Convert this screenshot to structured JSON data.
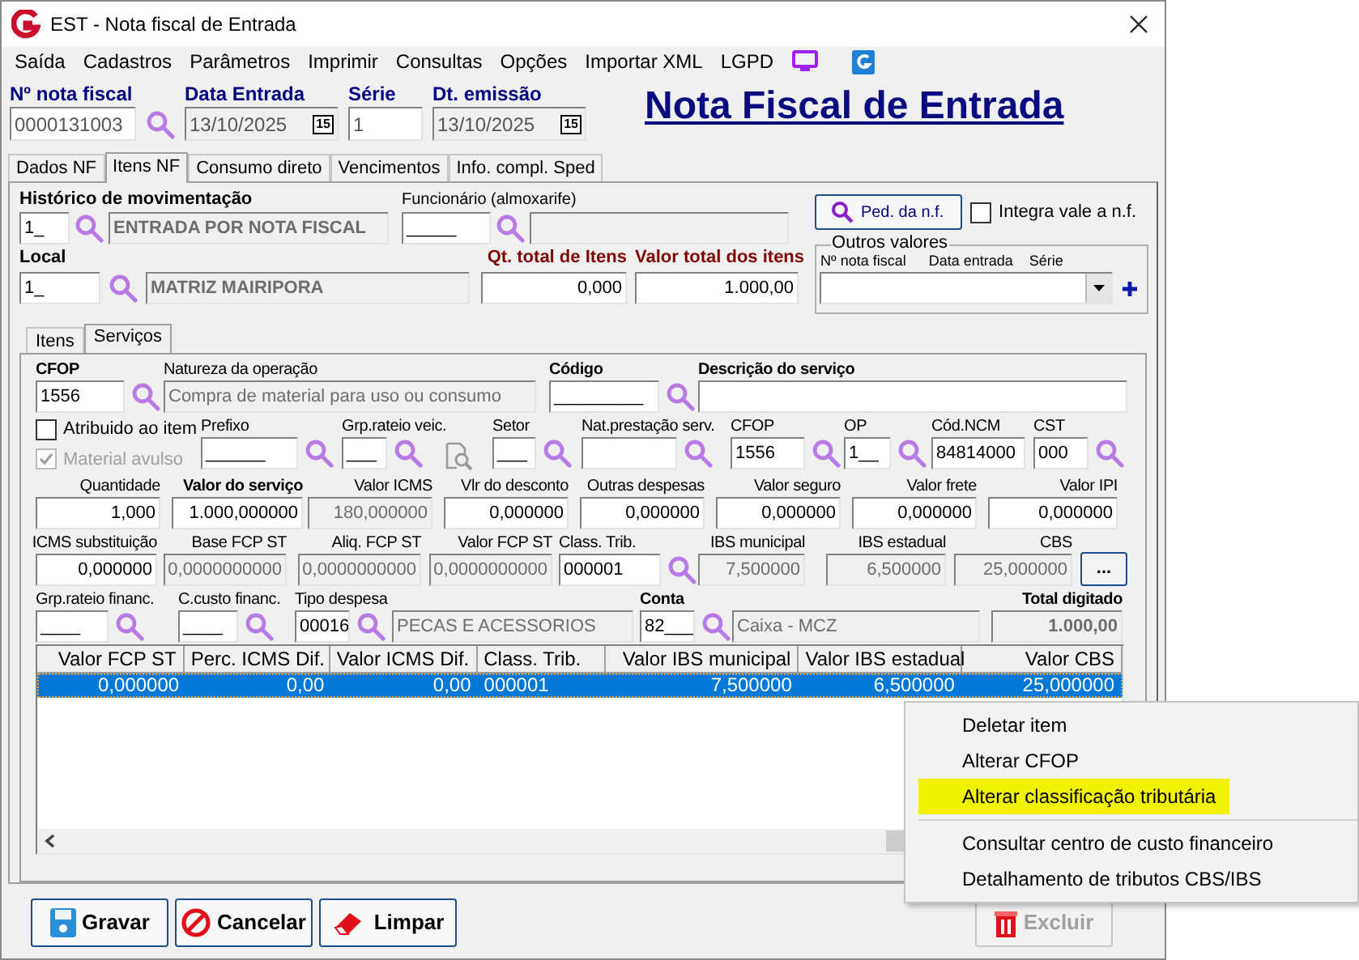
{
  "window": {
    "title": "EST - Nota fiscal de Entrada"
  },
  "menu": [
    {
      "label": "Saída"
    },
    {
      "label": "Cadastros"
    },
    {
      "label": "Parâmetros"
    },
    {
      "label": "Imprimir"
    },
    {
      "label": "Consultas"
    },
    {
      "label": "Opções"
    },
    {
      "label": "Importar XML"
    },
    {
      "label": "LGPD"
    }
  ],
  "header": {
    "title": "Nota Fiscal de Entrada",
    "fields": [
      {
        "label": "Nº nota fiscal",
        "value": "0000131003",
        "readonly": false,
        "lookup": true
      },
      {
        "label": "Data Entrada",
        "value": "13/10/2025",
        "readonly": true,
        "calendar": "15"
      },
      {
        "label": "Série",
        "value": "1",
        "readonly": false
      },
      {
        "label": "Dt. emissão",
        "value": "13/10/2025",
        "readonly": true,
        "calendar": "15"
      }
    ]
  },
  "tabs": [
    {
      "label": "Dados NF",
      "selected": false
    },
    {
      "label": "Itens NF",
      "selected": true
    },
    {
      "label": "Consumo direto",
      "selected": false
    },
    {
      "label": "Vencimentos",
      "selected": false
    },
    {
      "label": "Info. compl. Sped",
      "selected": false
    }
  ],
  "historico": {
    "label": "Histórico de movimentação",
    "code": "1_",
    "description": "ENTRADA POR NOTA FISCAL"
  },
  "funcionario": {
    "label": "Funcionário (almoxarife)",
    "code": "_____"
  },
  "pedido_button": {
    "label": "Ped. da n.f."
  },
  "integra_vale": {
    "label": "Integra vale a n.f.",
    "checked": false
  },
  "outros_valores": {
    "title": "Outros valores",
    "columns": [
      "Nº nota fiscal",
      "Data entrada",
      "Série"
    ]
  },
  "local": {
    "label": "Local",
    "code": "1_",
    "description": "MATRIZ MAIRIPORA"
  },
  "qt_total": {
    "label": "Qt. total de Itens",
    "value": "0,000"
  },
  "valor_total": {
    "label": "Valor total dos itens",
    "value": "1.000,00"
  },
  "subtabs": [
    {
      "label": "Itens",
      "selected": false
    },
    {
      "label": "Serviços",
      "selected": true
    }
  ],
  "servicos": {
    "rows": [
      {
        "fields": [
          {
            "kind": "field",
            "label": "CFOP",
            "strong": true,
            "value": "1556",
            "readonly": false,
            "lookup": true
          },
          {
            "kind": "field",
            "label": "Natureza da operação",
            "value": "Compra de material para uso ou consumo",
            "readonly": true
          },
          {
            "kind": "field",
            "label": "Código",
            "strong": true,
            "value": "_________",
            "readonly": false,
            "lookup": true
          },
          {
            "kind": "field",
            "label": "Descrição do serviço",
            "strong": true,
            "readonly": false
          }
        ]
      },
      {
        "fields": [
          {
            "kind": "checks",
            "items": [
              {
                "label": "Atribuido ao item",
                "checked": false,
                "disabled": false
              },
              {
                "label": "Material avulso",
                "checked": true,
                "disabled": true
              }
            ]
          },
          {
            "kind": "field",
            "label": "Prefixo",
            "value": "______",
            "readonly": false,
            "lookup": true
          },
          {
            "kind": "field",
            "label": "Grp.rateio veic.",
            "value": "___",
            "readonly": false,
            "lookup": true
          },
          {
            "kind": "tool"
          },
          {
            "kind": "field",
            "label": "Setor",
            "value": "___",
            "readonly": false,
            "lookup": true
          },
          {
            "kind": "field",
            "label": "Nat.prestação serv.",
            "readonly": false,
            "lookup": true
          },
          {
            "kind": "field",
            "label": "CFOP",
            "value": "1556",
            "readonly": false,
            "lookup": true
          },
          {
            "kind": "field",
            "label": "OP",
            "value": "1__",
            "readonly": false,
            "lookup": true
          },
          {
            "kind": "field",
            "label": "Cód.NCM",
            "value": "84814000",
            "readonly": false
          },
          {
            "kind": "field",
            "label": "CST",
            "value": "000",
            "readonly": false,
            "lookup": true
          }
        ]
      },
      {
        "fields": [
          {
            "kind": "field",
            "label": "Quantidade",
            "value": "1,000",
            "readonly": false,
            "numeric": true
          },
          {
            "kind": "field",
            "label": "Valor do serviço",
            "strong": true,
            "value": "1.000,000000",
            "readonly": false,
            "numeric": true
          },
          {
            "kind": "field",
            "label": "Valor ICMS",
            "value": "180,000000",
            "readonly": true,
            "numeric": true
          },
          {
            "kind": "field",
            "label": "Vlr do desconto",
            "value": "0,000000",
            "readonly": false,
            "numeric": true
          },
          {
            "kind": "field",
            "label": "Outras despesas",
            "value": "0,000000",
            "readonly": false,
            "numeric": true
          },
          {
            "kind": "field",
            "label": "Valor seguro",
            "value": "0,000000",
            "readonly": false,
            "numeric": true
          },
          {
            "kind": "field",
            "label": "Valor frete",
            "value": "0,000000",
            "readonly": false,
            "numeric": true
          },
          {
            "kind": "field",
            "label": "Valor IPI",
            "value": "0,000000",
            "readonly": false,
            "numeric": true
          }
        ]
      },
      {
        "fields": [
          {
            "kind": "field",
            "label": "ICMS substituição",
            "value": "0,000000",
            "readonly": false,
            "numeric": true
          },
          {
            "kind": "field",
            "label": "Base FCP ST",
            "value": "0,0000000000",
            "readonly": true,
            "numeric": true
          },
          {
            "kind": "field",
            "label": "Aliq. FCP ST",
            "value": "0,0000000000",
            "readonly": true,
            "numeric": true
          },
          {
            "kind": "field",
            "label": "Valor FCP ST",
            "value": "0,0000000000",
            "readonly": true,
            "numeric": true
          },
          {
            "kind": "field",
            "label": "Class. Trib.",
            "value": "000001",
            "readonly": false,
            "lookup": true
          },
          {
            "kind": "field",
            "label": "IBS municipal",
            "value": "7,500000",
            "readonly": true,
            "numeric": true
          },
          {
            "kind": "field",
            "label": "IBS estadual",
            "value": "6,500000",
            "readonly": true,
            "numeric": true
          },
          {
            "kind": "field",
            "label": "CBS",
            "value": "25,000000",
            "readonly": true,
            "numeric": true
          },
          {
            "kind": "button",
            "label": "..."
          }
        ]
      },
      {
        "fields": [
          {
            "kind": "field",
            "label": "Grp.rateio financ.",
            "value": "____",
            "readonly": false,
            "lookup": true
          },
          {
            "kind": "field",
            "label": "C.custo financ.",
            "value": "____",
            "readonly": false,
            "lookup": true
          },
          {
            "kind": "field",
            "label": "Tipo despesa",
            "value": "00016",
            "readonly": false,
            "lookup": true
          },
          {
            "kind": "field",
            "value": "PECAS E ACESSORIOS",
            "readonly": true
          },
          {
            "kind": "field",
            "label": "Conta",
            "strong": true,
            "value": "82___",
            "readonly": false,
            "lookup": true
          },
          {
            "kind": "field",
            "value": "Caixa - MCZ",
            "readonly": true
          },
          {
            "kind": "field",
            "label": "Total digitado",
            "strong": true,
            "value": "1.000,00",
            "readonly": true,
            "numeric": true
          }
        ]
      }
    ]
  },
  "grid": {
    "columns": [
      {
        "label": "Valor FCP ST"
      },
      {
        "label": "Perc. ICMS Dif."
      },
      {
        "label": "Valor ICMS Dif."
      },
      {
        "label": "Class. Trib."
      },
      {
        "label": "Valor IBS municipal"
      },
      {
        "label": "Valor IBS estadual"
      },
      {
        "label": "Valor CBS"
      }
    ],
    "rows": [
      {
        "selected": true,
        "cells": [
          "0,000000",
          "0,00",
          "0,00",
          "000001",
          "7,500000",
          "6,500000",
          "25,000000"
        ]
      }
    ]
  },
  "buttons": [
    {
      "kind": "save",
      "label": "Gravar",
      "disabled": false
    },
    {
      "kind": "cancel",
      "label": "Cancelar",
      "disabled": false
    },
    {
      "kind": "clear",
      "label": "Limpar",
      "disabled": false
    },
    {
      "kind": "delete",
      "label": "Excluir",
      "disabled": true
    }
  ],
  "context_menu": [
    {
      "kind": "item",
      "label": "Deletar item",
      "selected": false
    },
    {
      "kind": "item",
      "label": "Alterar CFOP",
      "selected": false
    },
    {
      "kind": "item",
      "label": "Alterar classificação tributária",
      "selected": true
    },
    {
      "kind": "separator"
    },
    {
      "kind": "item",
      "label": "Consultar centro de custo financeiro",
      "selected": false
    },
    {
      "kind": "item",
      "label": "Detalhamento de tributos CBS/IBS",
      "selected": false
    }
  ]
}
